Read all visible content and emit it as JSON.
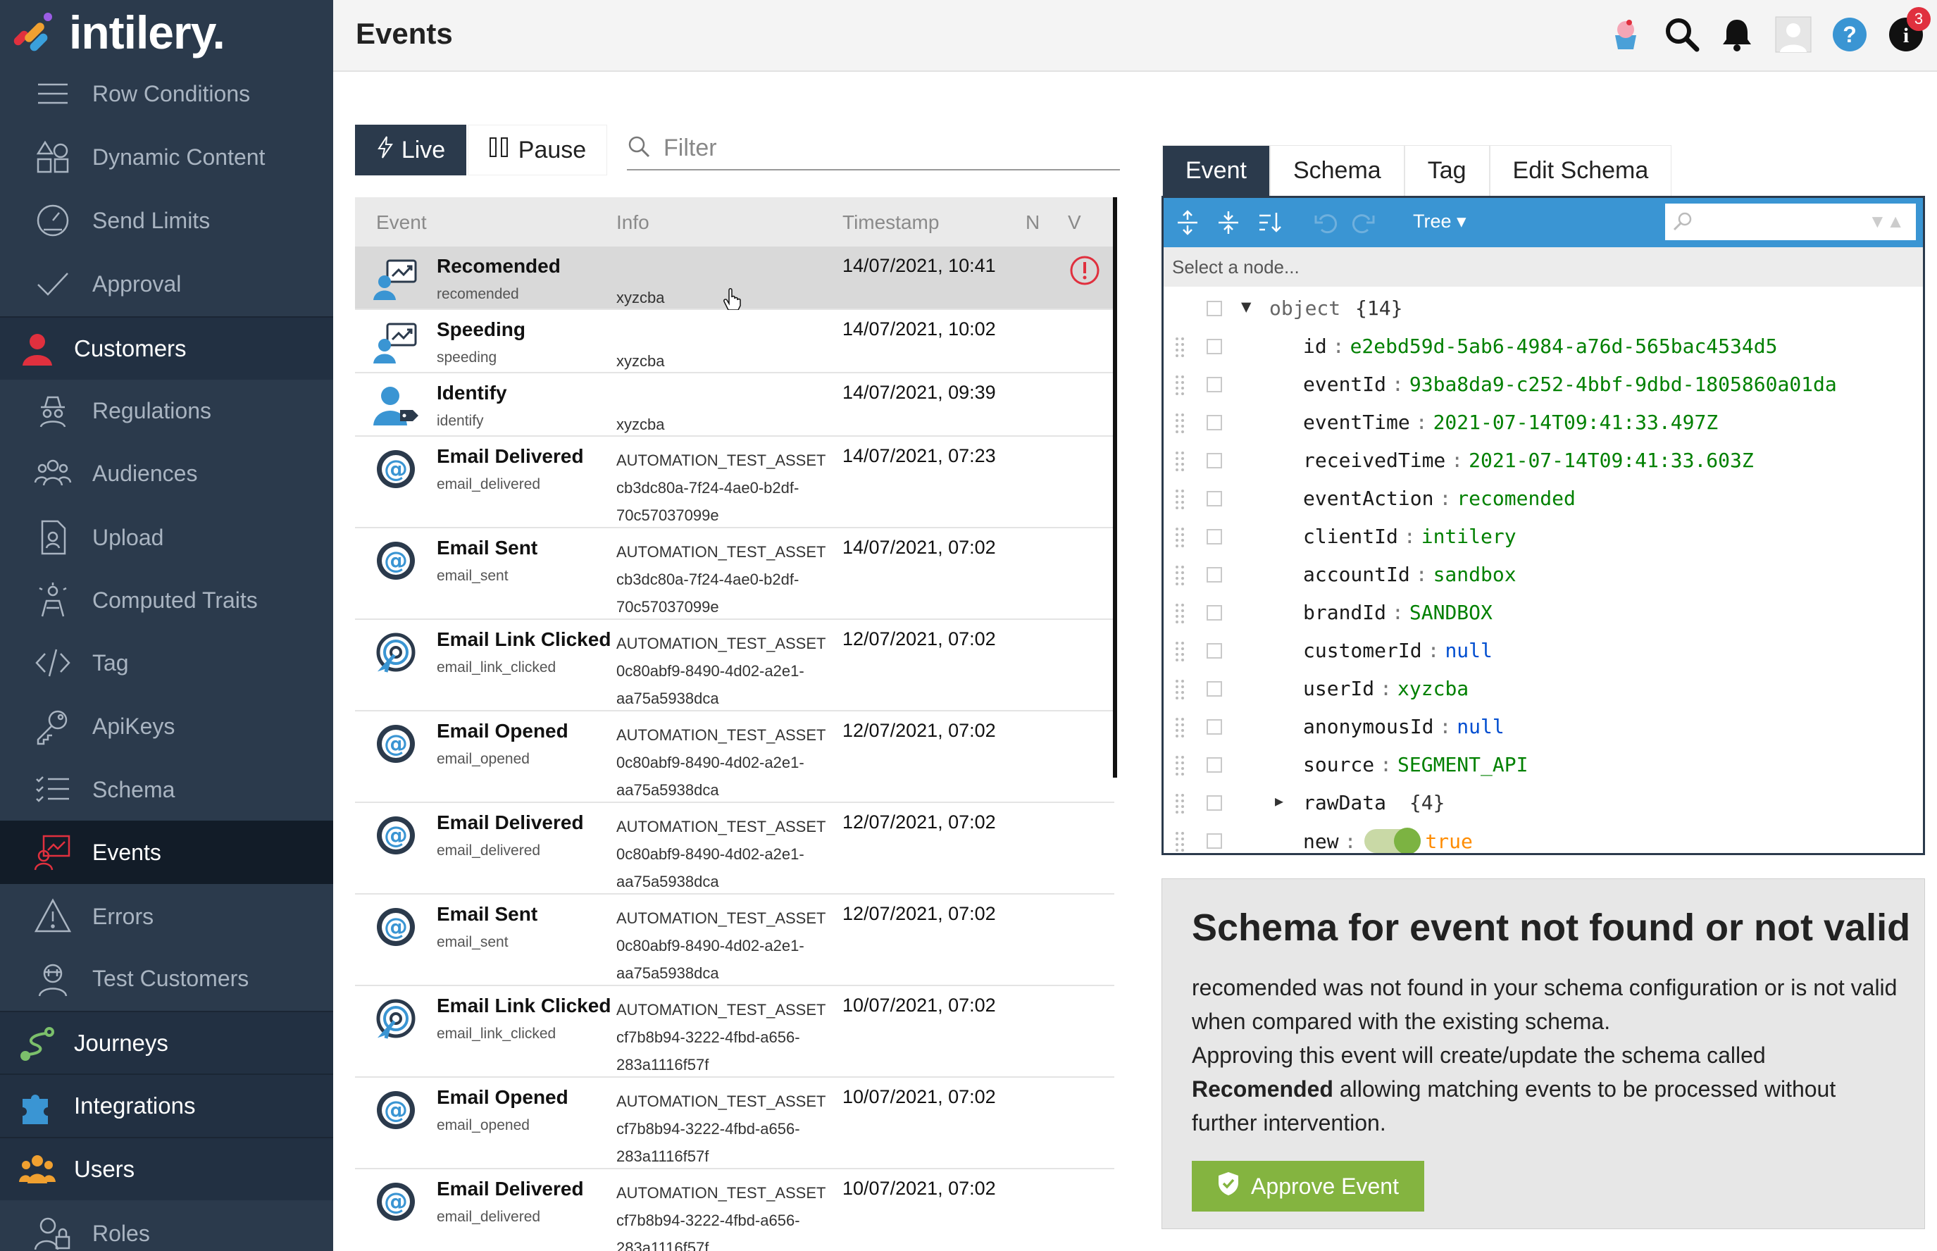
{
  "app": {
    "brand": "intilery.",
    "page_title": "Events"
  },
  "colors": {
    "sidebar": "#2b3a4c",
    "accent_blue": "#3a95d3",
    "approve_green": "#84b440",
    "warning_red": "#e0303e"
  },
  "sidebar": {
    "items": [
      {
        "label": "Row Conditions",
        "icon": "list-icon"
      },
      {
        "label": "Dynamic Content",
        "icon": "shapes-icon"
      },
      {
        "label": "Send Limits",
        "icon": "gauge-icon"
      },
      {
        "label": "Approval",
        "icon": "check-icon"
      },
      {
        "label": "Customers",
        "icon": "person-icon",
        "section": true
      },
      {
        "label": "Regulations",
        "icon": "detective-icon"
      },
      {
        "label": "Audiences",
        "icon": "group-icon"
      },
      {
        "label": "Upload",
        "icon": "upload-doc-icon"
      },
      {
        "label": "Computed Traits",
        "icon": "traits-icon"
      },
      {
        "label": "Tag",
        "icon": "code-icon"
      },
      {
        "label": "ApiKeys",
        "icon": "key-icon"
      },
      {
        "label": "Schema",
        "icon": "schema-list-icon"
      },
      {
        "label": "Events",
        "icon": "events-icon",
        "active": true
      },
      {
        "label": "Errors",
        "icon": "warning-icon"
      },
      {
        "label": "Test Customers",
        "icon": "test-user-icon"
      },
      {
        "label": "Journeys",
        "icon": "journey-icon",
        "section": true
      },
      {
        "label": "Integrations",
        "icon": "puzzle-icon",
        "section": true
      },
      {
        "label": "Users",
        "icon": "users-icon",
        "section": true
      },
      {
        "label": "Roles",
        "icon": "roles-icon"
      }
    ]
  },
  "topbar": {
    "notification_count": "3"
  },
  "controls": {
    "live_label": "Live",
    "pause_label": "Pause",
    "filter_placeholder": "Filter"
  },
  "table": {
    "headers": {
      "event": "Event",
      "info": "Info",
      "timestamp": "Timestamp",
      "n": "N",
      "v": "V"
    },
    "rows": [
      {
        "name": "Recomended",
        "sub": "recomended",
        "info": [
          "",
          "xyzcba"
        ],
        "timestamp": "14/07/2021, 10:41",
        "icon": "track-icon",
        "selected": true,
        "warning": true
      },
      {
        "name": "Speeding",
        "sub": "speeding",
        "info": [
          "",
          "xyzcba"
        ],
        "timestamp": "14/07/2021, 10:02",
        "icon": "track-icon"
      },
      {
        "name": "Identify",
        "sub": "identify",
        "info": [
          "",
          "xyzcba"
        ],
        "timestamp": "14/07/2021, 09:39",
        "icon": "identify-icon"
      },
      {
        "name": "Email Delivered",
        "sub": "email_delivered",
        "info": [
          "AUTOMATION_TEST_ASSET",
          "cb3dc80a-7f24-4ae0-b2df-",
          "70c57037099e"
        ],
        "timestamp": "14/07/2021, 07:23",
        "icon": "at-icon"
      },
      {
        "name": "Email Sent",
        "sub": "email_sent",
        "info": [
          "AUTOMATION_TEST_ASSET",
          "cb3dc80a-7f24-4ae0-b2df-",
          "70c57037099e"
        ],
        "timestamp": "14/07/2021, 07:02",
        "icon": "at-icon"
      },
      {
        "name": "Email Link Clicked",
        "sub": "email_link_clicked",
        "info": [
          "AUTOMATION_TEST_ASSET",
          "0c80abf9-8490-4d02-a2e1-",
          "aa75a5938dca"
        ],
        "timestamp": "12/07/2021, 07:02",
        "icon": "click-icon"
      },
      {
        "name": "Email Opened",
        "sub": "email_opened",
        "info": [
          "AUTOMATION_TEST_ASSET",
          "0c80abf9-8490-4d02-a2e1-",
          "aa75a5938dca"
        ],
        "timestamp": "12/07/2021, 07:02",
        "icon": "at-icon"
      },
      {
        "name": "Email Delivered",
        "sub": "email_delivered",
        "info": [
          "AUTOMATION_TEST_ASSET",
          "0c80abf9-8490-4d02-a2e1-",
          "aa75a5938dca"
        ],
        "timestamp": "12/07/2021, 07:02",
        "icon": "at-icon"
      },
      {
        "name": "Email Sent",
        "sub": "email_sent",
        "info": [
          "AUTOMATION_TEST_ASSET",
          "0c80abf9-8490-4d02-a2e1-",
          "aa75a5938dca"
        ],
        "timestamp": "12/07/2021, 07:02",
        "icon": "at-icon"
      },
      {
        "name": "Email Link Clicked",
        "sub": "email_link_clicked",
        "info": [
          "AUTOMATION_TEST_ASSET",
          "cf7b8b94-3222-4fbd-a656-",
          "283a1116f57f"
        ],
        "timestamp": "10/07/2021, 07:02",
        "icon": "click-icon"
      },
      {
        "name": "Email Opened",
        "sub": "email_opened",
        "info": [
          "AUTOMATION_TEST_ASSET",
          "cf7b8b94-3222-4fbd-a656-",
          "283a1116f57f"
        ],
        "timestamp": "10/07/2021, 07:02",
        "icon": "at-icon"
      },
      {
        "name": "Email Delivered",
        "sub": "email_delivered",
        "info": [
          "AUTOMATION_TEST_ASSET",
          "cf7b8b94-3222-4fbd-a656-",
          "283a1116f57f"
        ],
        "timestamp": "10/07/2021, 07:02",
        "icon": "at-icon"
      }
    ]
  },
  "tabs": [
    {
      "label": "Event",
      "active": true
    },
    {
      "label": "Schema"
    },
    {
      "label": "Tag"
    },
    {
      "label": "Edit Schema"
    }
  ],
  "editor": {
    "mode": "Tree",
    "nav_text": "Select a node...",
    "root": {
      "key": "object",
      "summary": "{14}"
    },
    "fields": [
      {
        "key": "id",
        "value": "e2ebd59d-5ab6-4984-a76d-565bac4534d5",
        "type": "string"
      },
      {
        "key": "eventId",
        "value": "93ba8da9-c252-4bbf-9dbd-1805860a01da",
        "type": "string"
      },
      {
        "key": "eventTime",
        "value": "2021-07-14T09:41:33.497Z",
        "type": "string"
      },
      {
        "key": "receivedTime",
        "value": "2021-07-14T09:41:33.603Z",
        "type": "string"
      },
      {
        "key": "eventAction",
        "value": "recomended",
        "type": "string"
      },
      {
        "key": "clientId",
        "value": "intilery",
        "type": "string"
      },
      {
        "key": "accountId",
        "value": "sandbox",
        "type": "string"
      },
      {
        "key": "brandId",
        "value": "SANDBOX",
        "type": "string"
      },
      {
        "key": "customerId",
        "value": "null",
        "type": "null"
      },
      {
        "key": "userId",
        "value": "xyzcba",
        "type": "string"
      },
      {
        "key": "anonymousId",
        "value": "null",
        "type": "null"
      },
      {
        "key": "source",
        "value": "SEGMENT_API",
        "type": "string"
      },
      {
        "key": "rawData",
        "value": "{4}",
        "type": "object"
      },
      {
        "key": "new",
        "value": "true",
        "type": "bool"
      }
    ]
  },
  "schema_card": {
    "heading": "Schema for event not found or not valid",
    "line1": "recomended was not found in your schema configuration or is not valid when compared with the existing schema.",
    "line2_prefix": "Approving this event will create/update the schema called ",
    "line2_bold": "Recomended",
    "line2_suffix": " allowing matching events to be processed without further intervention.",
    "approve_label": "Approve Event"
  }
}
